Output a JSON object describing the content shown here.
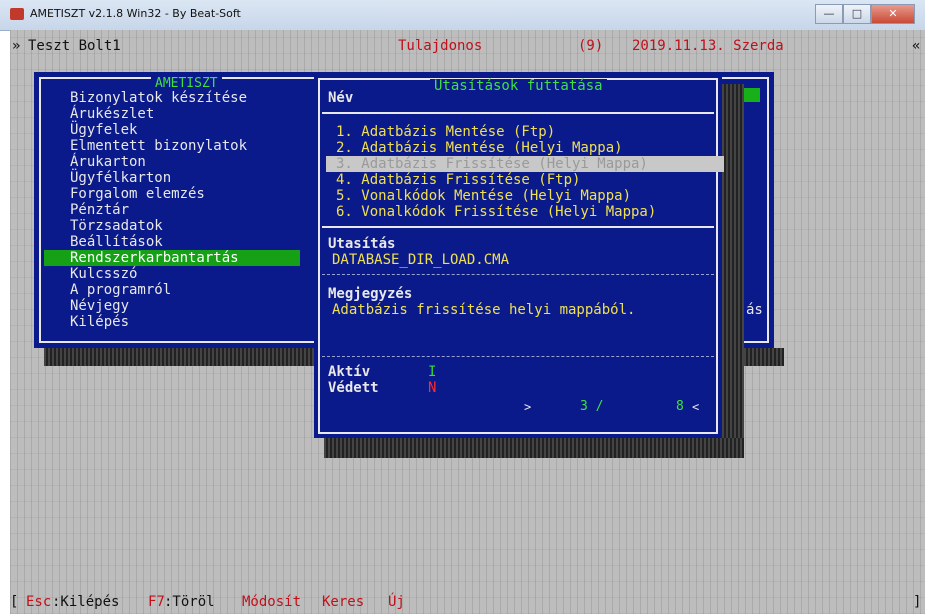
{
  "window": {
    "title": "AMETISZT v2.1.8 Win32  -  By Beat-Soft",
    "btn_minimize": "—",
    "btn_maximize": "□",
    "btn_close": "✕"
  },
  "status_top": {
    "prefix": "»",
    "shop": "Teszt Bolt1",
    "role": "Tulajdonos",
    "count": "(9)",
    "date": "2019.11.13. Szerda",
    "right_mark": "«"
  },
  "menu": {
    "title": "AMETISZT",
    "items": [
      "Bizonylatok készítése",
      "Árukészlet",
      "Ügyfelek",
      "Elmentett bizonylatok",
      "Árukarton",
      "Ügyfélkarton",
      "Forgalom elemzés",
      "Pénztár",
      "Törzsadatok",
      "Beállítások",
      "Rendszerkarbantartás",
      "Kulcsszó",
      "A programról",
      "Névjegy",
      "Kilépés"
    ],
    "active_index": 10,
    "side_text": "ás"
  },
  "dialog": {
    "title": "Utasítások futtatása",
    "col_name": "Név",
    "options": [
      "1. Adatbázis Mentése (Ftp)",
      "2. Adatbázis Mentése (Helyi Mappa)",
      "3. Adatbázis Frissítése (Helyi Mappa)",
      "4. Adatbázis Frissítése (Ftp)",
      "5. Vonalkódok Mentése (Helyi Mappa)",
      "6. Vonalkódok Frissítése (Helyi Mappa)"
    ],
    "selected_index": 2,
    "command_label": "Utasítás",
    "command_value": "DATABASE_DIR_LOAD.CMA",
    "note_label": "Megjegyzés",
    "note_value": "Adatbázis frissítése helyi mappából.",
    "active_label": "Aktív",
    "active_value": "I",
    "protected_label": "Védett",
    "protected_value": "N",
    "counter_current": "3 /",
    "counter_total": "8",
    "arrow_right": ">",
    "arrow_left": "<"
  },
  "status_bottom": {
    "bracket_left": "[",
    "esc_key": "Esc",
    "esc_label": ":Kilépés",
    "f7_key": "F7",
    "f7_label": ":Töröl",
    "modify": "Módosít",
    "search": "Keres",
    "new": "Új",
    "bracket_right": "]"
  },
  "colors": {
    "console_bg": "#bdbdbd",
    "panel_blue": "#0a1a8a",
    "highlight_green": "#15a015",
    "text_yellow": "#f0e050",
    "text_red": "#c0101a"
  }
}
